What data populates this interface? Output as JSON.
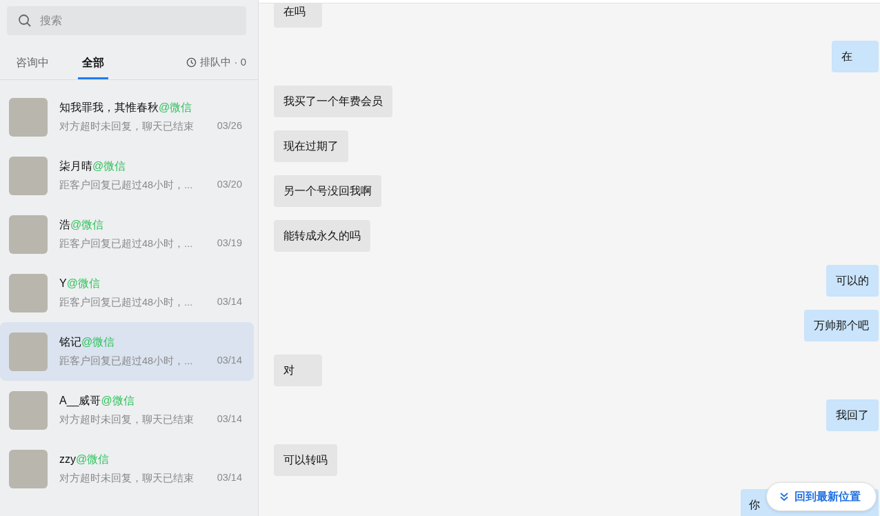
{
  "sidebar": {
    "search": {
      "placeholder": "搜索"
    },
    "tabs": [
      {
        "label": "咨询中",
        "selected": false
      },
      {
        "label": "全部",
        "selected": true
      }
    ],
    "queue": "排队中 · 0",
    "contacts": [
      {
        "name": "知我罪我，其惟春秋",
        "channel": "@微信",
        "preview": "对方超时未回复，聊天已结束",
        "date": "03/26",
        "selected": false
      },
      {
        "name": "柒月晴",
        "channel": "@微信",
        "preview": "距客户回复已超过48小时，...",
        "date": "03/20",
        "selected": false
      },
      {
        "name": "浩",
        "channel": "@微信",
        "preview": "距客户回复已超过48小时，...",
        "date": "03/19",
        "selected": false
      },
      {
        "name": "Y",
        "channel": "@微信",
        "preview": "距客户回复已超过48小时，...",
        "date": "03/14",
        "selected": false
      },
      {
        "name": "铭记",
        "channel": "@微信",
        "preview": "距客户回复已超过48小时，...",
        "date": "03/14",
        "selected": true
      },
      {
        "name": "A__威哥",
        "channel": "@微信",
        "preview": "对方超时未回复，聊天已结束",
        "date": "03/14",
        "selected": false
      },
      {
        "name": "zzy",
        "channel": "@微信",
        "preview": "对方超时未回复，聊天已结束",
        "date": "03/14",
        "selected": false
      }
    ]
  },
  "chat": {
    "messages": [
      {
        "kind": "incoming",
        "text": "在吗"
      },
      {
        "kind": "outgoing",
        "text": "在"
      },
      {
        "kind": "incoming",
        "text": "我买了一个年费会员"
      },
      {
        "kind": "incoming",
        "text": "现在过期了"
      },
      {
        "kind": "incoming",
        "text": "另一个号没回我啊"
      },
      {
        "kind": "incoming",
        "text": "能转成永久的吗"
      },
      {
        "kind": "outgoing",
        "text": "可以的"
      },
      {
        "kind": "outgoing",
        "text": "万帅那个吧"
      },
      {
        "kind": "incoming",
        "text": "对"
      },
      {
        "kind": "outgoing",
        "text": "我回了"
      },
      {
        "kind": "incoming",
        "text": "可以转吗"
      },
      {
        "kind": "outgoing",
        "text": "你",
        "covered": true
      }
    ],
    "jump_button": "回到最新位置"
  }
}
